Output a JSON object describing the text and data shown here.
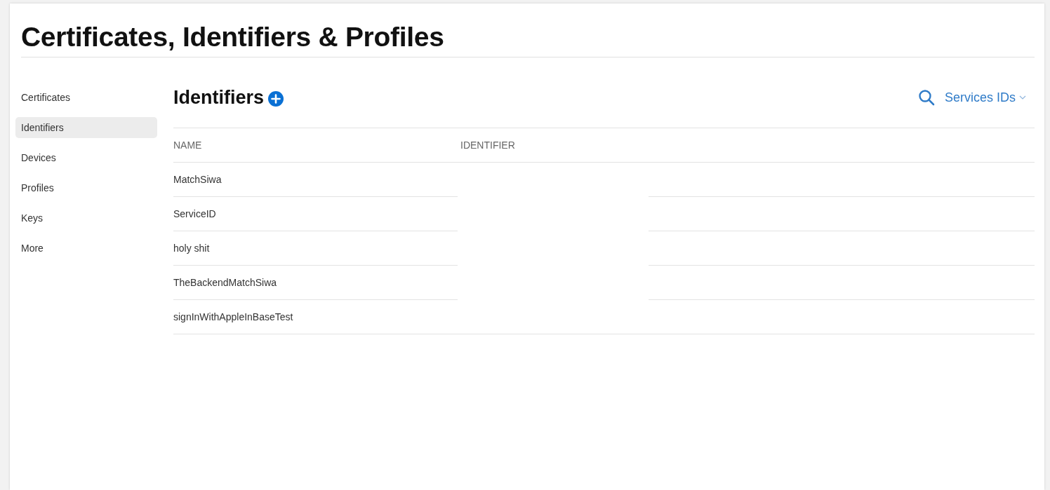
{
  "page": {
    "title": "Certificates, Identifiers & Profiles"
  },
  "sidebar": {
    "items": [
      {
        "label": "Certificates",
        "selected": false
      },
      {
        "label": "Identifiers",
        "selected": true
      },
      {
        "label": "Devices",
        "selected": false
      },
      {
        "label": "Profiles",
        "selected": false
      },
      {
        "label": "Keys",
        "selected": false
      },
      {
        "label": "More",
        "selected": false
      }
    ]
  },
  "section": {
    "title": "Identifiers",
    "filter": "Services IDs"
  },
  "table": {
    "columns": [
      "NAME",
      "IDENTIFIER"
    ],
    "rows": [
      {
        "name": "MatchSiwa"
      },
      {
        "name": "ServiceID"
      },
      {
        "name": "holy shit"
      },
      {
        "name": "TheBackendMatchSiwa"
      },
      {
        "name": "signInWithAppleInBaseTest"
      }
    ]
  }
}
